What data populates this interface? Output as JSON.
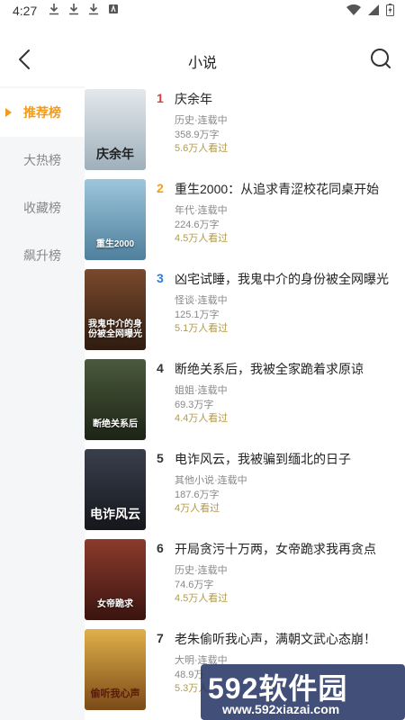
{
  "status": {
    "time": "4:27"
  },
  "header": {
    "title": "小说"
  },
  "sidebar": {
    "items": [
      {
        "label": "推荐榜",
        "active": true
      },
      {
        "label": "大热榜",
        "active": false
      },
      {
        "label": "收藏榜",
        "active": false
      },
      {
        "label": "飙升榜",
        "active": false
      }
    ]
  },
  "books": [
    {
      "rank": "1",
      "title": "庆余年",
      "meta": "历史·连载中",
      "words": "358.9万字",
      "views": "5.6万人看过",
      "cover_text": "庆余年",
      "cover_color": "#c9d2d8"
    },
    {
      "rank": "2",
      "title": "重生2000：从追求青涩校花同桌开始",
      "meta": "年代·连载中",
      "words": "224.6万字",
      "views": "4.5万人看过",
      "cover_text": "重生2000",
      "cover_color": "#7fb0c9"
    },
    {
      "rank": "3",
      "title": "凶宅试睡，我鬼中介的身份被全网曝光",
      "meta": "怪谈·连载中",
      "words": "125.1万字",
      "views": "5.1万人看过",
      "cover_text": "我鬼中介的身份被全网曝光",
      "cover_color": "#5a3320"
    },
    {
      "rank": "4",
      "title": "断绝关系后，我被全家跪着求原谅",
      "meta": "姐姐·连载中",
      "words": "69.3万字",
      "views": "4.4万人看过",
      "cover_text": "断绝关系后",
      "cover_color": "#2f3a2a"
    },
    {
      "rank": "5",
      "title": "电诈风云，我被骗到缅北的日子",
      "meta": "其他小说·连载中",
      "words": "187.6万字",
      "views": "4万人看过",
      "cover_text": "电诈风云",
      "cover_color": "#2c2f3a"
    },
    {
      "rank": "6",
      "title": "开局贪污十万两，女帝跪求我再贪点",
      "meta": "历史·连载中",
      "words": "74.6万字",
      "views": "4.5万人看过",
      "cover_text": "女帝跪求",
      "cover_color": "#6b2a22"
    },
    {
      "rank": "7",
      "title": "老朱偷听我心声，满朝文武心态崩！",
      "meta": "大明·连载中",
      "words": "48.9万",
      "views": "5.3万人",
      "cover_text": "偷听我心声",
      "cover_color": "#b8842c"
    }
  ],
  "watermark": {
    "main": "592软件园",
    "url": "www.592xiazai.com"
  },
  "colors": {
    "accent": "#f29a1a",
    "rank1": "#e23b3b",
    "rank2": "#f2a01a",
    "rank3": "#2b7de0"
  }
}
